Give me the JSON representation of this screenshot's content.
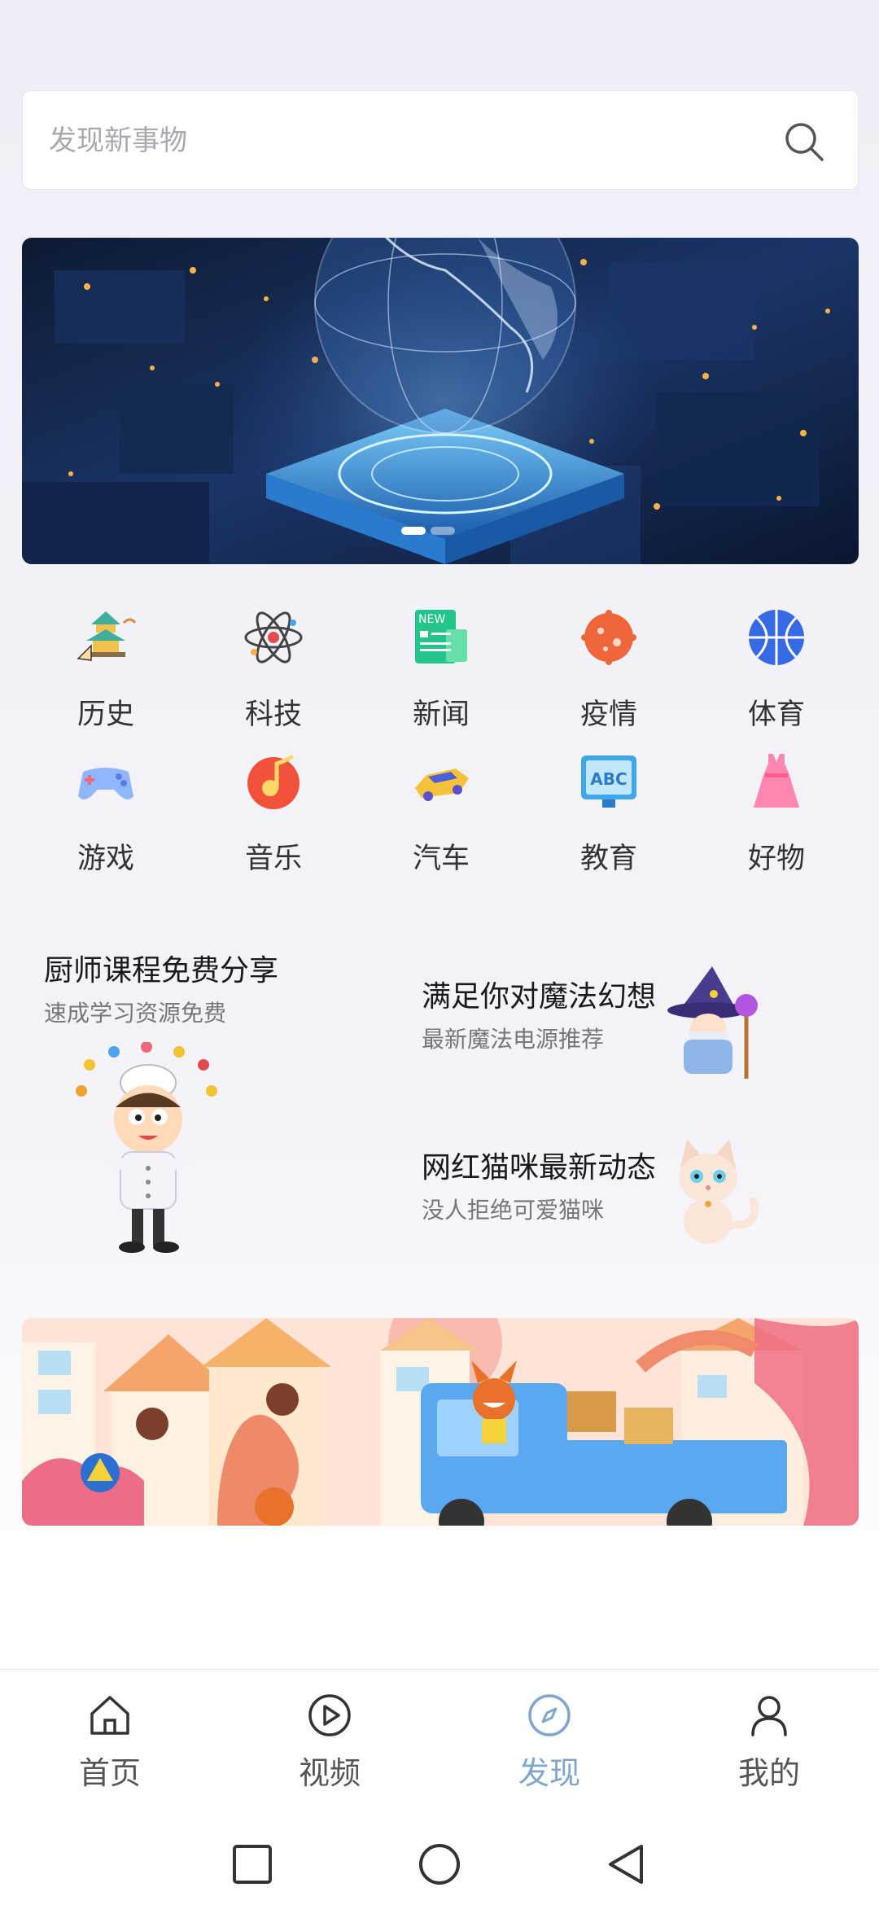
{
  "search": {
    "placeholder": "发现新事物"
  },
  "categories": [
    {
      "label": "历史",
      "icon": "pagoda-icon"
    },
    {
      "label": "科技",
      "icon": "atom-icon"
    },
    {
      "label": "新闻",
      "icon": "news-icon",
      "badge": "NEW"
    },
    {
      "label": "疫情",
      "icon": "virus-icon"
    },
    {
      "label": "体育",
      "icon": "basketball-icon"
    },
    {
      "label": "游戏",
      "icon": "gamepad-icon"
    },
    {
      "label": "音乐",
      "icon": "music-icon"
    },
    {
      "label": "汽车",
      "icon": "car-icon"
    },
    {
      "label": "教育",
      "icon": "abc-board-icon",
      "badge": "ABC"
    },
    {
      "label": "好物",
      "icon": "dress-icon"
    }
  ],
  "promo": {
    "chef": {
      "title": "厨师课程免费分享",
      "subtitle": "速成学习资源免费"
    },
    "magic": {
      "title": "满足你对魔法幻想",
      "subtitle": "最新魔法电源推荐"
    },
    "cat": {
      "title": "网红猫咪最新动态",
      "subtitle": "没人拒绝可爱猫咪"
    }
  },
  "bottom_nav": [
    {
      "label": "首页",
      "icon": "home-icon",
      "active": false
    },
    {
      "label": "视频",
      "icon": "play-circle-icon",
      "active": false
    },
    {
      "label": "发现",
      "icon": "compass-icon",
      "active": true
    },
    {
      "label": "我的",
      "icon": "user-icon",
      "active": false
    }
  ],
  "colors": {
    "accent": "#7fa6cf",
    "text": "#333333",
    "subtext": "#777777"
  }
}
